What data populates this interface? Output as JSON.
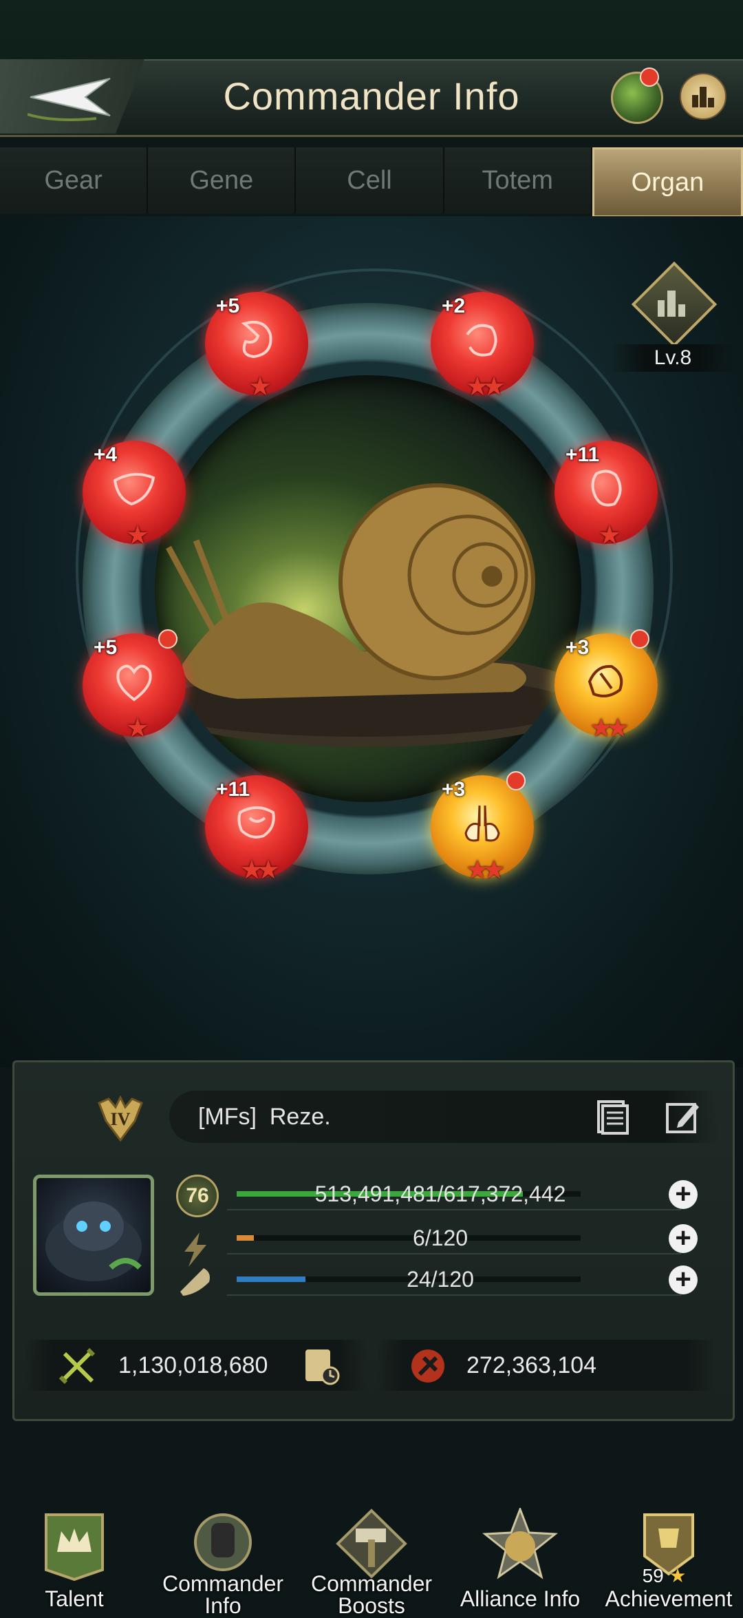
{
  "header": {
    "title": "Commander Info",
    "back_icon": "back-arrow-icon",
    "pet_icon": "pet-icon",
    "rank_icon": "ranking-icon"
  },
  "tabs": [
    {
      "label": "Gear",
      "active": false
    },
    {
      "label": "Gene",
      "active": false
    },
    {
      "label": "Cell",
      "active": false
    },
    {
      "label": "Totem",
      "active": false
    },
    {
      "label": "Organ",
      "active": true
    }
  ],
  "organ_level": "Lv.8",
  "organs": [
    {
      "id": "top-left",
      "bonus": "+5",
      "stars": "★",
      "color": "red",
      "notify": false
    },
    {
      "id": "top-right",
      "bonus": "+2",
      "stars": "★★",
      "color": "red",
      "notify": false
    },
    {
      "id": "upper-left",
      "bonus": "+4",
      "stars": "★",
      "color": "red",
      "notify": false
    },
    {
      "id": "upper-right",
      "bonus": "+11",
      "stars": "★",
      "color": "red",
      "notify": false
    },
    {
      "id": "mid-left",
      "bonus": "+5",
      "stars": "★",
      "color": "red",
      "notify": true
    },
    {
      "id": "mid-right",
      "bonus": "+3",
      "stars": "★★",
      "color": "gold",
      "notify": true
    },
    {
      "id": "bottom-left",
      "bonus": "+11",
      "stars": "★★",
      "color": "red",
      "notify": false
    },
    {
      "id": "bottom-right",
      "bonus": "+3",
      "stars": "★★",
      "color": "gold",
      "notify": true
    }
  ],
  "profile": {
    "rank_emblem": "IV",
    "name": "[MFs]  Reze.",
    "level": "76",
    "exp": {
      "text": "513,491,481/617,372,442",
      "fraction": 0.832
    },
    "stamina": {
      "text": "6/120",
      "fraction": 0.05
    },
    "energy": {
      "text": "24/120",
      "fraction": 0.2
    },
    "power": "1,130,018,680",
    "kills": "272,363,104"
  },
  "colors": {
    "exp_bar": "#3aa83a",
    "stamina_bar": "#d88a3a",
    "energy_bar": "#2f7ec4",
    "accent_gold": "#c9ab6b"
  },
  "nav": {
    "talent": "Talent",
    "commander_info": "Commander\nInfo",
    "commander_boosts": "Commander\nBoosts",
    "alliance_info": "Alliance Info",
    "achievement": "Achievement",
    "achievement_count": "59"
  }
}
